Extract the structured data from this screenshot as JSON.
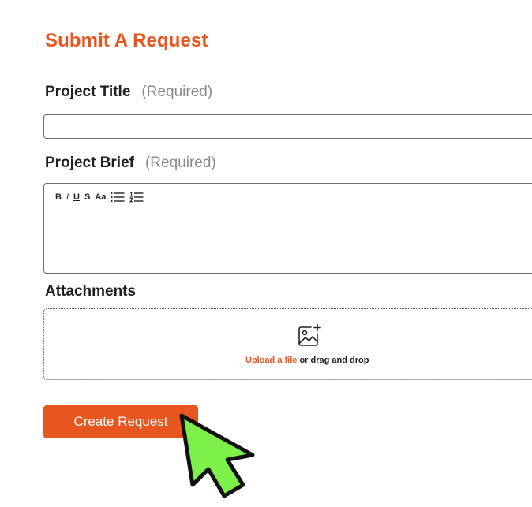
{
  "page": {
    "title": "Submit A Request"
  },
  "fields": {
    "project_title": {
      "label": "Project Title",
      "required_text": "(Required)",
      "value": ""
    },
    "project_brief": {
      "label": "Project Brief",
      "required_text": "(Required)",
      "value": "",
      "toolbar": {
        "bold": "B",
        "italic": "I",
        "underline": "U",
        "strike": "S",
        "font_size": "Aa",
        "bullet_list_icon": "bullet-list-icon",
        "numbered_list_icon": "numbered-list-icon"
      }
    },
    "attachments": {
      "label": "Attachments",
      "upload_link": "Upload a file",
      "upload_rest": " or drag and drop",
      "icon": "image-add-icon"
    }
  },
  "actions": {
    "create_label": "Create Request"
  },
  "colors": {
    "accent": "#e8561f",
    "cursor_fill": "#7ef04a",
    "cursor_outline": "#111111"
  }
}
